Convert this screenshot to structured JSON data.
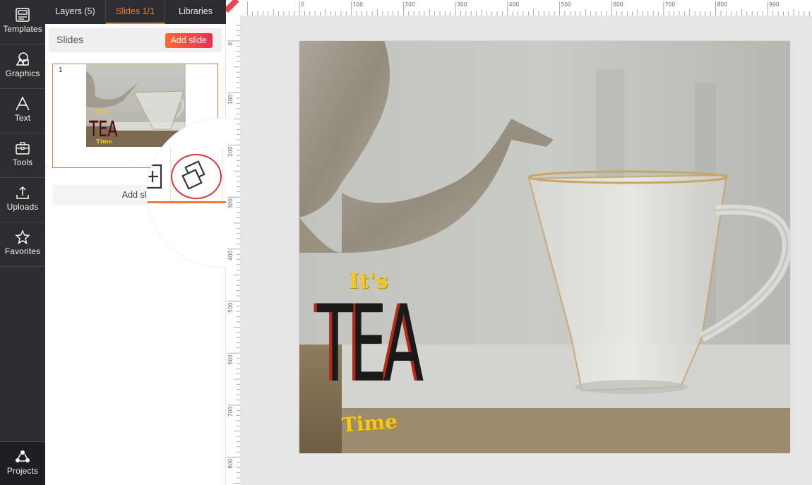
{
  "sidebar": {
    "items": [
      {
        "label": "Templates",
        "icon": "templates-icon"
      },
      {
        "label": "Graphics",
        "icon": "graphics-icon"
      },
      {
        "label": "Text",
        "icon": "text-icon"
      },
      {
        "label": "Tools",
        "icon": "tools-icon"
      },
      {
        "label": "Uploads",
        "icon": "uploads-icon"
      },
      {
        "label": "Favorites",
        "icon": "favorites-icon"
      }
    ],
    "projects_label": "Projects"
  },
  "panel": {
    "tabs": [
      {
        "label": "Layers (5)",
        "active": false
      },
      {
        "label": "Slides 1/1",
        "active": true
      },
      {
        "label": "Libraries",
        "active": false
      }
    ],
    "slides_title": "Slides",
    "add_slide_label": "Add slide",
    "slide_number": "1",
    "add_slide_bottom_label": "Add sli",
    "thumbnail_text": {
      "its": "It's",
      "tea": "TEA",
      "time": "Time"
    }
  },
  "magnifier": {
    "actions": [
      "add-slide-icon",
      "duplicate-slide-icon",
      "delete-slide-icon"
    ],
    "highlighted": "duplicate-slide-icon",
    "highlight_color": "#e1303c"
  },
  "rulers": {
    "top": [
      "0",
      "100",
      "200",
      "300",
      "400",
      "500",
      "600",
      "700",
      "800",
      "900"
    ],
    "left": [
      "0",
      "100",
      "200",
      "300",
      "400",
      "500",
      "600",
      "700",
      "800"
    ]
  },
  "canvas": {
    "text_its": "It's",
    "text_tea": "TEA",
    "text_time": "Time"
  },
  "colors": {
    "accent": "#f07a2e",
    "button_gradient_start": "#ff6a2c",
    "button_gradient_end": "#ef2b55",
    "rail_bg": "#2d2d31",
    "yellow_text": "#f5c918",
    "red_shadow": "#b42a1a"
  }
}
